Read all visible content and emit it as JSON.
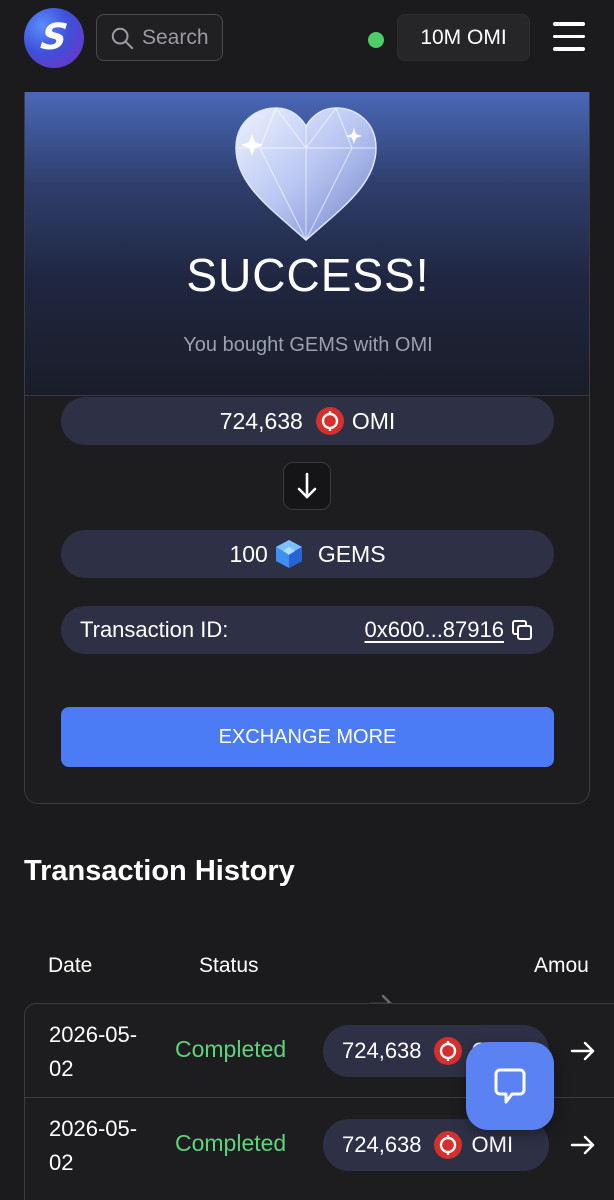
{
  "header": {
    "logo_letter": "S",
    "search_placeholder": "Search",
    "status_color": "#4ecc6a",
    "balance_label": "10M OMI",
    "menu_icon": "hamburger-menu-icon"
  },
  "success": {
    "title": "SUCCESS!",
    "subtitle": "You bought GEMS with OMI",
    "from": {
      "amount": "724,638",
      "currency": "OMI",
      "icon": "omi-coin-icon"
    },
    "to": {
      "amount": "100",
      "currency": "GEMS",
      "icon": "gem-cube-icon"
    },
    "transaction_id_label": "Transaction ID:",
    "transaction_id_value": "0x600...87916",
    "exchange_button": "EXCHANGE MORE"
  },
  "history": {
    "title": "Transaction History",
    "columns": [
      "Date",
      "Status",
      "Amou"
    ],
    "rows": [
      {
        "date": "2026-05-02",
        "status": "Completed",
        "amount": "724,638",
        "currency": "OMI"
      },
      {
        "date": "2026-05-02",
        "status": "Completed",
        "amount": "724,638",
        "currency": "OMI"
      }
    ]
  },
  "colors": {
    "accent": "#4b7cf6",
    "status_completed": "#5fd27a",
    "omi_coin": "#d6302c",
    "gem": "#3d8ff0"
  }
}
